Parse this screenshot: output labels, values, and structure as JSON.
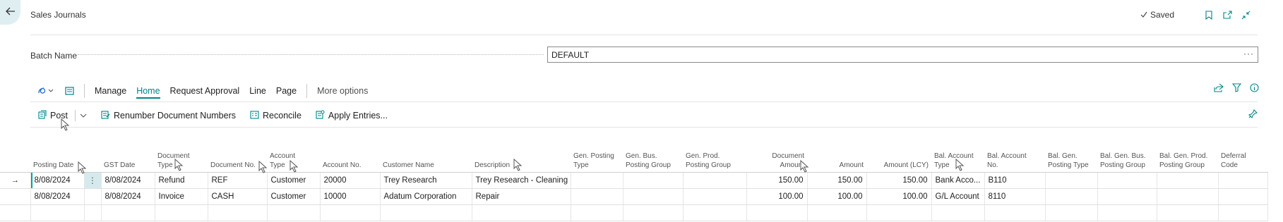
{
  "header": {
    "title": "Sales Journals",
    "saved_label": "Saved",
    "icons": [
      "back-arrow-icon",
      "bookmark-icon",
      "open-new-window-icon",
      "collapse-icon"
    ]
  },
  "batch": {
    "label": "Batch Name",
    "value": "DEFAULT",
    "lookup": "···"
  },
  "toolbar": {
    "items": [
      "Manage",
      "Home",
      "Request Approval",
      "Line",
      "Page"
    ],
    "active": "Home",
    "more": "More options",
    "right_icons": [
      "share-icon",
      "filter-icon",
      "info-icon"
    ]
  },
  "actions": {
    "post": "Post",
    "renumber": "Renumber Document Numbers",
    "reconcile": "Reconcile",
    "apply": "Apply Entries..."
  },
  "columns": [
    "Posting Date",
    "GST Date",
    "Document Type",
    "Document No.",
    "Account Type",
    "Account No.",
    "Customer Name",
    "Description",
    "Gen. Posting Type",
    "Gen. Bus. Posting Group",
    "Gen. Prod. Posting Group",
    "Document Amount",
    "Amount",
    "Amount (LCY)",
    "Bal. Account Type",
    "Bal. Account No.",
    "Bal. Gen. Posting Type",
    "Bal. Gen. Bus. Posting Group",
    "Bal. Gen. Prod. Posting Group",
    "Deferral Code"
  ],
  "column_headers": {
    "posting_date": "Posting Date",
    "gst_date": "GST Date",
    "document_type": [
      "Document",
      "Type"
    ],
    "document_no": "Document No.",
    "account_type": [
      "Account",
      "Type"
    ],
    "account_no": "Account No.",
    "customer_name": "Customer Name",
    "description": "Description",
    "gen_posting_type": [
      "Gen. Posting",
      "Type"
    ],
    "gen_bus_posting_group": [
      "Gen. Bus.",
      "Posting Group"
    ],
    "gen_prod_posting_group": [
      "Gen. Prod.",
      "Posting Group"
    ],
    "document_amount": [
      "Document",
      "Amount"
    ],
    "amount": "Amount",
    "amount_lcy": "Amount (LCY)",
    "bal_account_type": [
      "Bal. Account",
      "Type"
    ],
    "bal_account_no": [
      "Bal. Account",
      "No."
    ],
    "bal_gen_posting_type": [
      "Bal. Gen.",
      "Posting Type"
    ],
    "bal_gen_bus_posting_group": [
      "Bal. Gen. Bus.",
      "Posting Group"
    ],
    "bal_gen_prod_posting_group": [
      "Bal. Gen. Prod.",
      "Posting Group"
    ],
    "deferral_code": "Deferral Code"
  },
  "rows": [
    {
      "indicator": "→",
      "menu": "⋮",
      "posting_date": "8/08/2024",
      "gst_date": "8/08/2024",
      "document_type": "Refund",
      "document_no": "REF",
      "account_type": "Customer",
      "account_no": "20000",
      "customer_name": "Trey Research",
      "description": "Trey Research - Cleaning",
      "gen_posting_type": "",
      "gen_bus_posting_group": "",
      "gen_prod_posting_group": "",
      "document_amount": "150.00",
      "amount": "150.00",
      "amount_lcy": "150.00",
      "bal_account_type": "Bank Acco...",
      "bal_account_no": "B110",
      "bal_gen_posting_type": "",
      "bal_gen_bus_posting_group": "",
      "bal_gen_prod_posting_group": "",
      "deferral_code": ""
    },
    {
      "indicator": "",
      "menu": "",
      "posting_date": "8/08/2024",
      "gst_date": "8/08/2024",
      "document_type": "Invoice",
      "document_no": "CASH",
      "account_type": "Customer",
      "account_no": "10000",
      "customer_name": "Adatum Corporation",
      "description": "Repair",
      "gen_posting_type": "",
      "gen_bus_posting_group": "",
      "gen_prod_posting_group": "",
      "document_amount": "100.00",
      "amount": "100.00",
      "amount_lcy": "100.00",
      "bal_account_type": "G/L Account",
      "bal_account_no": "8110",
      "bal_gen_posting_type": "",
      "bal_gen_bus_posting_group": "",
      "bal_gen_prod_posting_group": "",
      "deferral_code": ""
    }
  ],
  "colors": {
    "accent": "#008489",
    "selected_cell": "#d5eaec",
    "back_button": "#dfeff1"
  }
}
